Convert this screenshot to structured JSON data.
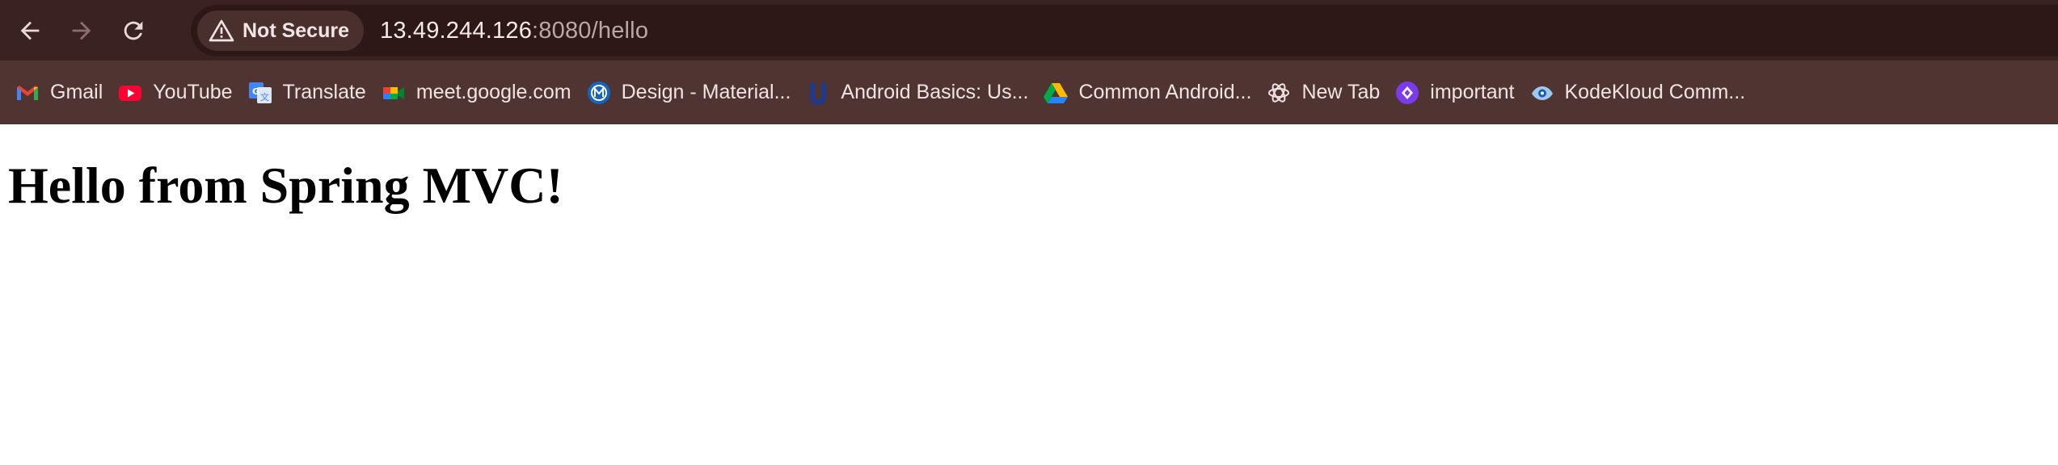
{
  "browser": {
    "security_label": "Not Secure",
    "url_host": "13.49.244.126",
    "url_rest": ":8080/hello"
  },
  "bookmarks": [
    {
      "label": "Gmail",
      "icon": "gmail-icon"
    },
    {
      "label": "YouTube",
      "icon": "youtube-icon"
    },
    {
      "label": "Translate",
      "icon": "translate-icon"
    },
    {
      "label": "meet.google.com",
      "icon": "google-meet-icon"
    },
    {
      "label": "Design - Material...",
      "icon": "material-design-icon"
    },
    {
      "label": "Android Basics: Us...",
      "icon": "udacity-icon"
    },
    {
      "label": "Common Android...",
      "icon": "google-drive-icon"
    },
    {
      "label": "New Tab",
      "icon": "openai-icon"
    },
    {
      "label": "important",
      "icon": "bookmark-app-icon"
    },
    {
      "label": "KodeKloud Comm...",
      "icon": "kodekloud-icon"
    }
  ],
  "page": {
    "heading": "Hello from Spring MVC!"
  },
  "colors": {
    "toolbar_bg": "#3a2220",
    "bookmarks_bg": "#4f3432",
    "omnibox_bg": "#2e1816",
    "text_light": "#f0e4e1"
  }
}
